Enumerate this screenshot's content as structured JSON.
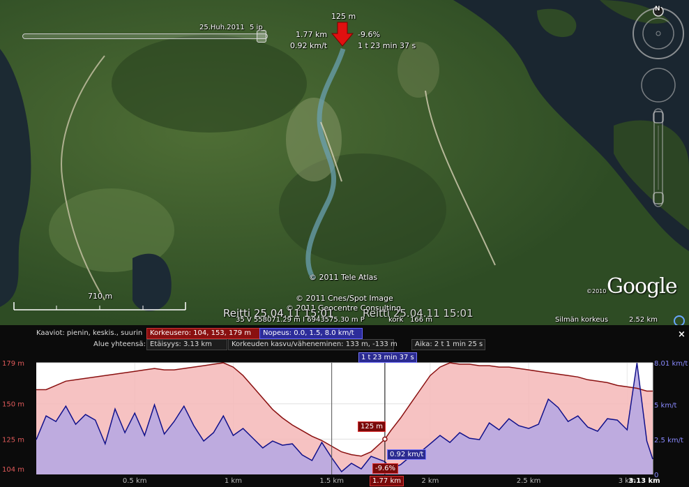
{
  "map": {
    "time_slider": {
      "date_label": "25.Huh.2011",
      "interval_label": "5 ip"
    },
    "marker": {
      "elevation": "125 m",
      "distance": "1.77 km",
      "grade": "-9.6%",
      "speed": "0.92 km/t",
      "elapsed": "1 t 23 min 37 s"
    },
    "credits": {
      "tele_atlas": "© 2011 Tele Atlas",
      "cnes": "© 2011 Cnes/Spot Image",
      "geocentre": "© 2011 Geocentre Consulting",
      "copyright_year": "©2010"
    },
    "google_logo": "Google",
    "route_label": "Reitti 25.04.11 15:01",
    "route_label_echo": "Reitti 25.04.11 15:01",
    "scale_label": "710 m",
    "compass_letter": "N",
    "status_bar": {
      "coords": "35 V 558071.29 m I 6943575.30 m P",
      "elevation_label": "kork",
      "elevation_value": "166 m",
      "eye_alt_label": "Silmän korkeus",
      "eye_alt_value": "2.52 km"
    }
  },
  "profile": {
    "charts_label": "Kaaviot: pienin, keskis., suurin",
    "elevation_stats": "Korkeusero: 104, 153, 179 m",
    "speed_stats": "Nopeus: 0.0, 1.5, 8.0 km/t",
    "totals_label": "Alue yhteensä:",
    "distance_total": "Etäisyys: 3.13 km",
    "gain_loss": "Korkeuden kasvu/väheneminen: 133 m, -133 m",
    "time_total": "Aika: 2 t 1 min 25 s",
    "close_label": "×",
    "cursor": {
      "time": "1 t 23 min 37 s",
      "elevation": "125 m",
      "speed": "0.92 km/t",
      "grade": "-9.6%",
      "distance": "1.77 km"
    }
  },
  "chart_data": {
    "type": "area",
    "x_unit": "km",
    "x": [
      0,
      0.05,
      0.1,
      0.15,
      0.2,
      0.25,
      0.3,
      0.35,
      0.4,
      0.45,
      0.5,
      0.55,
      0.6,
      0.65,
      0.7,
      0.75,
      0.8,
      0.85,
      0.9,
      0.95,
      1.0,
      1.05,
      1.1,
      1.15,
      1.2,
      1.25,
      1.3,
      1.35,
      1.4,
      1.45,
      1.5,
      1.55,
      1.6,
      1.65,
      1.7,
      1.77,
      1.8,
      1.85,
      1.9,
      1.95,
      2.0,
      2.05,
      2.1,
      2.15,
      2.2,
      2.25,
      2.3,
      2.35,
      2.4,
      2.45,
      2.5,
      2.55,
      2.6,
      2.65,
      2.7,
      2.75,
      2.8,
      2.85,
      2.9,
      2.95,
      3.0,
      3.05,
      3.1,
      3.13
    ],
    "series": [
      {
        "name": "Korkeus",
        "axis": "left",
        "unit": "m",
        "color": "#8a1010",
        "fill": "#f2b8b8",
        "values": [
          160,
          160,
          163,
          166,
          167,
          168,
          169,
          170,
          171,
          172,
          173,
          174,
          175,
          174,
          174,
          175,
          176,
          177,
          178,
          179,
          176,
          170,
          162,
          154,
          146,
          140,
          135,
          131,
          127,
          124,
          120,
          116,
          114,
          113,
          116,
          125,
          131,
          140,
          150,
          160,
          170,
          176,
          179,
          178,
          178,
          177,
          177,
          176,
          176,
          175,
          174,
          173,
          172,
          171,
          170,
          169,
          167,
          166,
          165,
          163,
          162,
          161,
          159,
          159
        ]
      },
      {
        "name": "Nopeus",
        "axis": "right",
        "unit": "km/t",
        "color": "#1a1a8a",
        "fill": "#b9a6e0",
        "values": [
          2.5,
          4.2,
          3.8,
          4.9,
          3.6,
          4.3,
          3.9,
          2.2,
          4.7,
          3.0,
          4.4,
          2.8,
          5.0,
          2.9,
          3.8,
          4.9,
          3.5,
          2.4,
          3.0,
          4.2,
          2.8,
          3.3,
          2.6,
          1.9,
          2.4,
          2.1,
          2.2,
          1.4,
          1.0,
          2.3,
          1.2,
          0.2,
          0.8,
          0.4,
          1.3,
          0.92,
          0.4,
          0.7,
          1.3,
          1.6,
          2.2,
          2.8,
          2.3,
          3.0,
          2.6,
          2.5,
          3.7,
          3.2,
          4.0,
          3.5,
          3.3,
          3.6,
          5.4,
          4.8,
          3.8,
          4.2,
          3.4,
          3.1,
          4.0,
          3.9,
          3.2,
          8.0,
          2.4,
          1.1
        ]
      }
    ],
    "x_ticks": [
      "0.5 km",
      "1 km",
      "1.5 km",
      "2 km",
      "2.5 km",
      "3 km",
      "3.13 km"
    ],
    "x_tick_values": [
      0.5,
      1.0,
      1.5,
      2.0,
      2.5,
      3.0,
      3.13
    ],
    "left_axis": {
      "ticks": [
        "104 m",
        "125 m",
        "150 m",
        "179 m"
      ],
      "tick_values": [
        104,
        125,
        150,
        179
      ],
      "range": [
        100,
        179
      ]
    },
    "right_axis": {
      "ticks": [
        "2.5 km/t",
        "5 km/t",
        "8.01 km/t"
      ],
      "tick_values": [
        2.5,
        5.0,
        8.01
      ],
      "range": [
        0,
        8.01
      ],
      "zero_label": "0"
    },
    "cursor_x": 1.77
  }
}
